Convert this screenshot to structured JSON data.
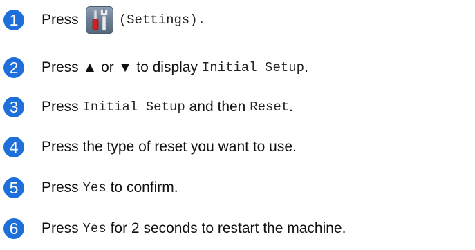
{
  "steps": [
    {
      "number": "1",
      "parts": [
        "Press",
        "(Settings)."
      ],
      "icon": "settings-icon"
    },
    {
      "number": "2",
      "parts": [
        "Press ▲ or ▼ to display",
        "Initial Setup",
        "."
      ]
    },
    {
      "number": "3",
      "parts": [
        "Press",
        "Initial Setup",
        "and then",
        "Reset",
        "."
      ]
    },
    {
      "number": "4",
      "parts": [
        "Press the type of reset you want to use."
      ]
    },
    {
      "number": "5",
      "parts": [
        "Press",
        "Yes",
        "to confirm."
      ]
    },
    {
      "number": "6",
      "parts": [
        "Press",
        "Yes",
        "for 2 seconds to restart the machine."
      ]
    }
  ],
  "colors": {
    "step_badge": "#1e6fd9",
    "icon_background": "#6f8196"
  }
}
